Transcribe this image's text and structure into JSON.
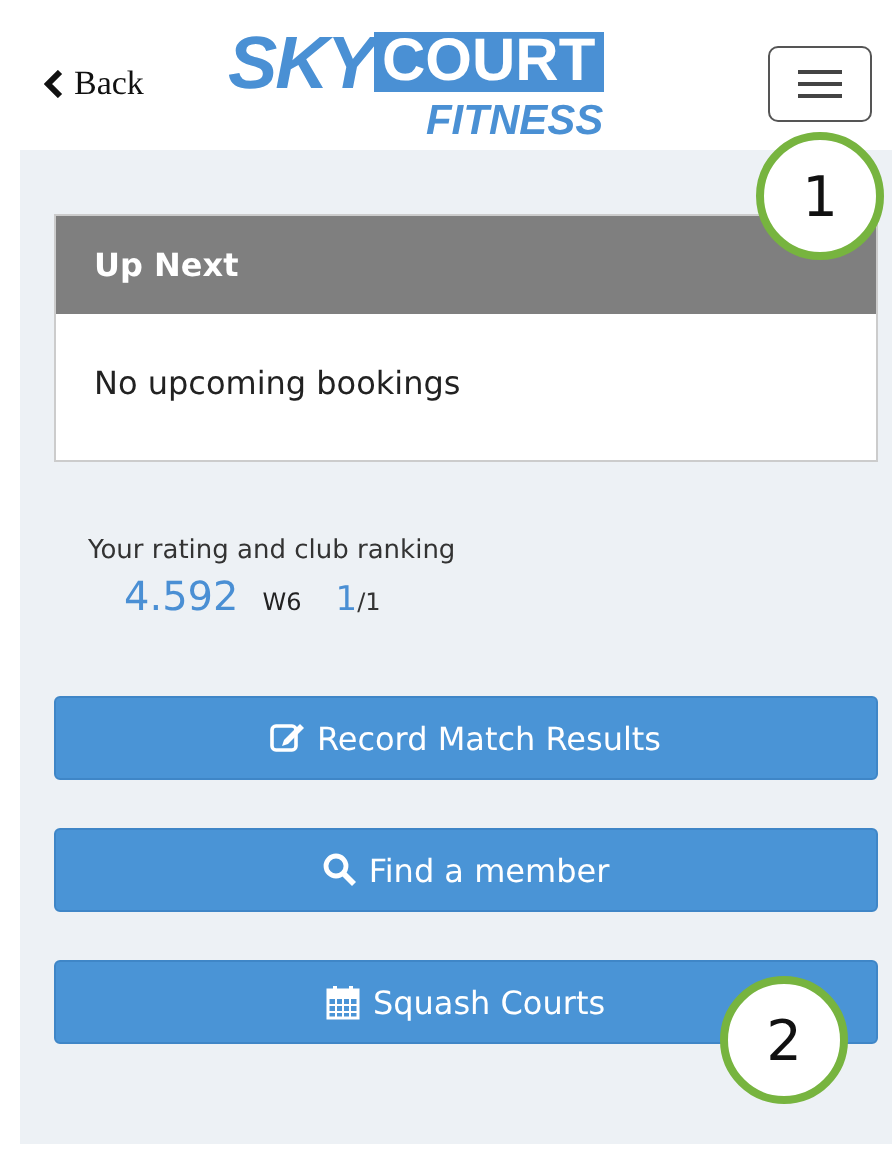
{
  "header": {
    "back": "Back",
    "logo": {
      "word_1": "SKY",
      "word_2": "COURT",
      "word_3": "FITNESS"
    }
  },
  "up_next": {
    "title": "Up Next",
    "message": "No upcoming bookings"
  },
  "rating": {
    "label": "Your rating and club ranking",
    "value": "4.592",
    "grade": "W6",
    "rank": "1",
    "rank_total": "/1"
  },
  "buttons": [
    {
      "kind": "edit",
      "label": "Record Match Results"
    },
    {
      "kind": "search",
      "label": "Find a member"
    },
    {
      "kind": "calendar",
      "label": "Squash Courts"
    }
  ],
  "callouts": [
    {
      "label": "1"
    },
    {
      "label": "2"
    }
  ]
}
